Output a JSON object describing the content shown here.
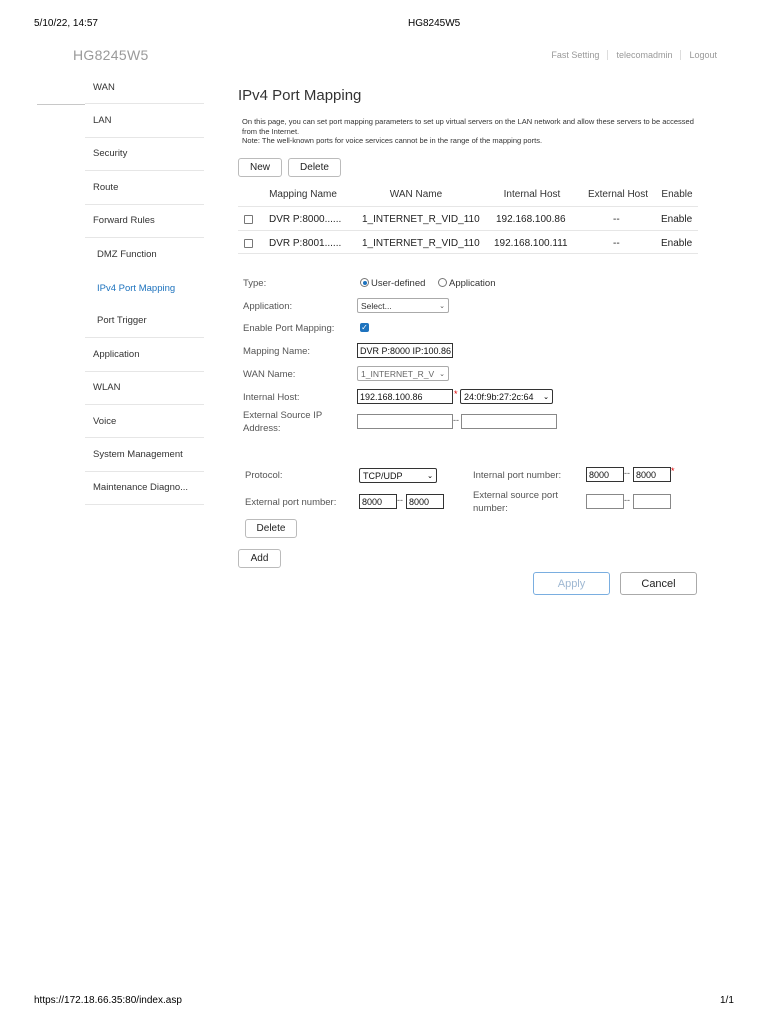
{
  "print": {
    "datetime": "5/10/22, 14:57",
    "title": "HG8245W5",
    "url": "https://172.18.66.35:80/index.asp",
    "page": "1/1"
  },
  "header": {
    "brand": "HG8245W5",
    "links": [
      "Fast Setting",
      "telecomadmin",
      "Logout"
    ]
  },
  "sidebar": {
    "items": [
      {
        "label": "WAN"
      },
      {
        "label": "LAN"
      },
      {
        "label": "Security"
      },
      {
        "label": "Route"
      },
      {
        "label": "Forward Rules"
      },
      {
        "label": "DMZ Function"
      },
      {
        "label": "IPv4 Port Mapping"
      },
      {
        "label": "Port Trigger"
      },
      {
        "label": "Application"
      },
      {
        "label": "WLAN"
      },
      {
        "label": "Voice"
      },
      {
        "label": "System Management"
      },
      {
        "label": "Maintenance Diagno..."
      }
    ]
  },
  "main": {
    "title": "IPv4 Port Mapping",
    "description_1": "On this page, you can set port mapping parameters to set up virtual servers on the LAN network and allow these servers to be accessed from the Internet.",
    "description_2": "Note: The well-known ports for voice services cannot be in the range of the mapping ports.",
    "new_label": "New",
    "delete_label": "Delete",
    "table": {
      "headers": [
        "Mapping Name",
        "WAN Name",
        "Internal Host",
        "External Host",
        "Enable"
      ],
      "rows": [
        {
          "name": "DVR P:8000......",
          "wan": "1_INTERNET_R_VID_110",
          "internal": "192.168.100.86",
          "external": "--",
          "enable": "Enable"
        },
        {
          "name": "DVR P:8001......",
          "wan": "1_INTERNET_R_VID_110",
          "internal": "192.168.100.111",
          "external": "--",
          "enable": "Enable"
        }
      ]
    },
    "form": {
      "type_label": "Type:",
      "type_user_defined": "User-defined",
      "type_application": "Application",
      "application_label": "Application:",
      "application_value": "Select...",
      "enable_label": "Enable Port Mapping:",
      "mapping_name_label": "Mapping Name:",
      "mapping_name_value": "DVR P:8000 IP:100.86",
      "wan_name_label": "WAN Name:",
      "wan_name_value": "1_INTERNET_R_V",
      "internal_host_label": "Internal Host:",
      "internal_host_value": "192.168.100.86",
      "mac_value": "24:0f:9b:27:2c:64",
      "ext_source_ip_label": "External Source IP Address:",
      "dash": "--",
      "star": "*"
    },
    "ports": {
      "protocol_label": "Protocol:",
      "protocol_value": "TCP/UDP",
      "internal_port_label": "Internal port number:",
      "internal_port_start": "8000",
      "internal_port_end": "8000",
      "external_port_label": "External port number:",
      "external_port_start": "8000",
      "external_port_end": "8000",
      "ext_source_port_label": "External source port number:",
      "delete_label": "Delete"
    },
    "add_label": "Add",
    "apply_label": "Apply",
    "cancel_label": "Cancel"
  },
  "colors": {
    "accent": "#1e73be",
    "required": "#dd0000"
  }
}
